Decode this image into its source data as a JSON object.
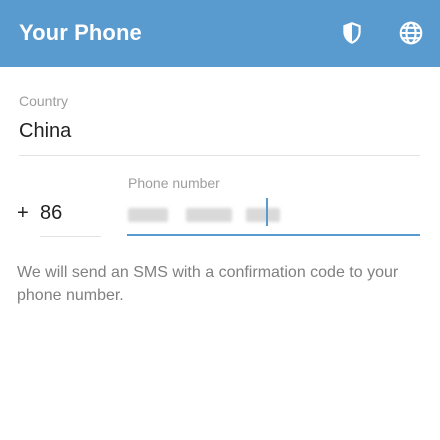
{
  "header": {
    "title": "Your Phone",
    "shield_icon": "shield-icon",
    "globe_icon": "globe-icon",
    "background_color": "#5a9bcf"
  },
  "country": {
    "label": "Country",
    "value": "China"
  },
  "phone": {
    "plus": "+",
    "code": "86",
    "label": "Phone number"
  },
  "info": {
    "text": "We will send an SMS with a confirmation code to your phone number."
  },
  "colors": {
    "accent": "#5a9bcf"
  }
}
